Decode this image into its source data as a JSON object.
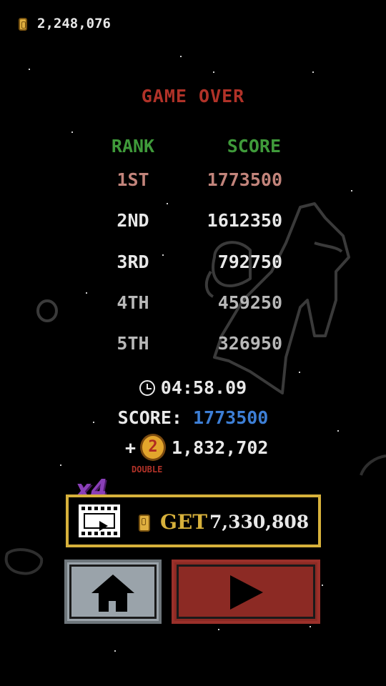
{
  "hud": {
    "coins": "2,248,076",
    "coin_icon": "coin-icon"
  },
  "title": "GAME OVER",
  "leaderboard": {
    "headers": {
      "rank": "RANK",
      "score": "SCORE"
    },
    "rows": [
      {
        "rank": "1ST",
        "score": "1773500",
        "color": "#c2847b"
      },
      {
        "rank": "2ND",
        "score": "1612350",
        "color": "#e8e8e8"
      },
      {
        "rank": "3RD",
        "score": "792750",
        "color": "#e8e8e8"
      },
      {
        "rank": "4TH",
        "score": "459250",
        "color": "#b8b8b8"
      },
      {
        "rank": "5TH",
        "score": "326950",
        "color": "#b8b8b8"
      }
    ]
  },
  "result": {
    "time": "04:58.09",
    "score_label": "SCORE:",
    "score_value": "1773500",
    "bonus_prefix": "+",
    "bonus_coin_label": "2",
    "bonus_amount": "1,832,702",
    "double_label": "DOUBLE"
  },
  "reward": {
    "multiplier": "x4",
    "get_label": "GET",
    "get_amount": "7,330,808",
    "icon": "video-ad-icon"
  },
  "buttons": {
    "home_icon": "home-icon",
    "play_icon": "play-icon"
  },
  "colors": {
    "title": "#b03228",
    "header": "#3f9a3a",
    "score_value": "#3d7fd6",
    "gold": "#d7b13b",
    "multiplier": "#8a3fb8",
    "play_button": "#8c2a24",
    "home_button": "#9aa3aa"
  }
}
